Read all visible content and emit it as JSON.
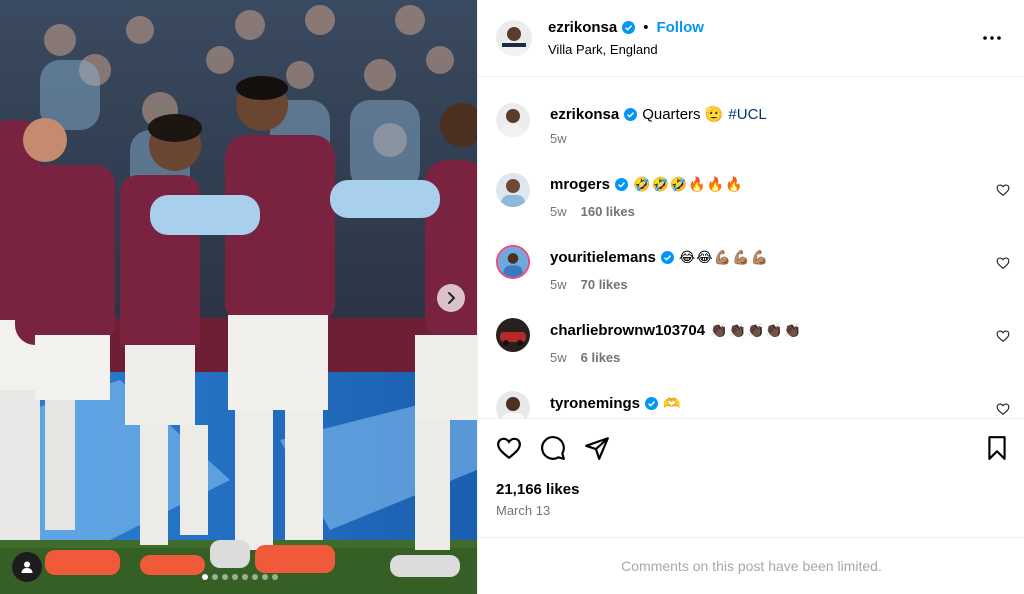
{
  "media": {
    "carousel_dots": 8,
    "active_dot": 0,
    "next_icon": "chevron-right-icon",
    "tag_icon": "user-tag-icon"
  },
  "post": {
    "author": "ezrikonsa",
    "follow_label": "Follow",
    "separator": "•",
    "location": "Villa Park, England",
    "more_icon": "more-options-icon",
    "likes": "21,166 likes",
    "date": "March 13",
    "comments_limited": "Comments on this post have been limited."
  },
  "caption": {
    "user": "ezrikonsa",
    "text": "Quarters 🫡",
    "hashtag": "#UCL",
    "time": "5w"
  },
  "comments": [
    {
      "user": "mrogers",
      "verified": true,
      "text": "🤣🤣🤣🔥🔥🔥",
      "time": "5w",
      "likes": "160 likes"
    },
    {
      "user": "youritielemans",
      "verified": true,
      "text": "😂😂💪🏽💪🏽💪🏽",
      "time": "5w",
      "likes": "70 likes"
    },
    {
      "user": "charliebrownw103704",
      "verified": false,
      "text": "👏🏿👏🏿👏🏿👏🏿👏🏿",
      "time": "5w",
      "likes": "6 likes"
    },
    {
      "user": "tyronemings",
      "verified": true,
      "text": "🫶",
      "time": "",
      "likes": ""
    }
  ],
  "colors": {
    "accent": "#0095f6",
    "verified": "#0095f6",
    "muted": "#737373",
    "hashtag": "#00376b"
  }
}
